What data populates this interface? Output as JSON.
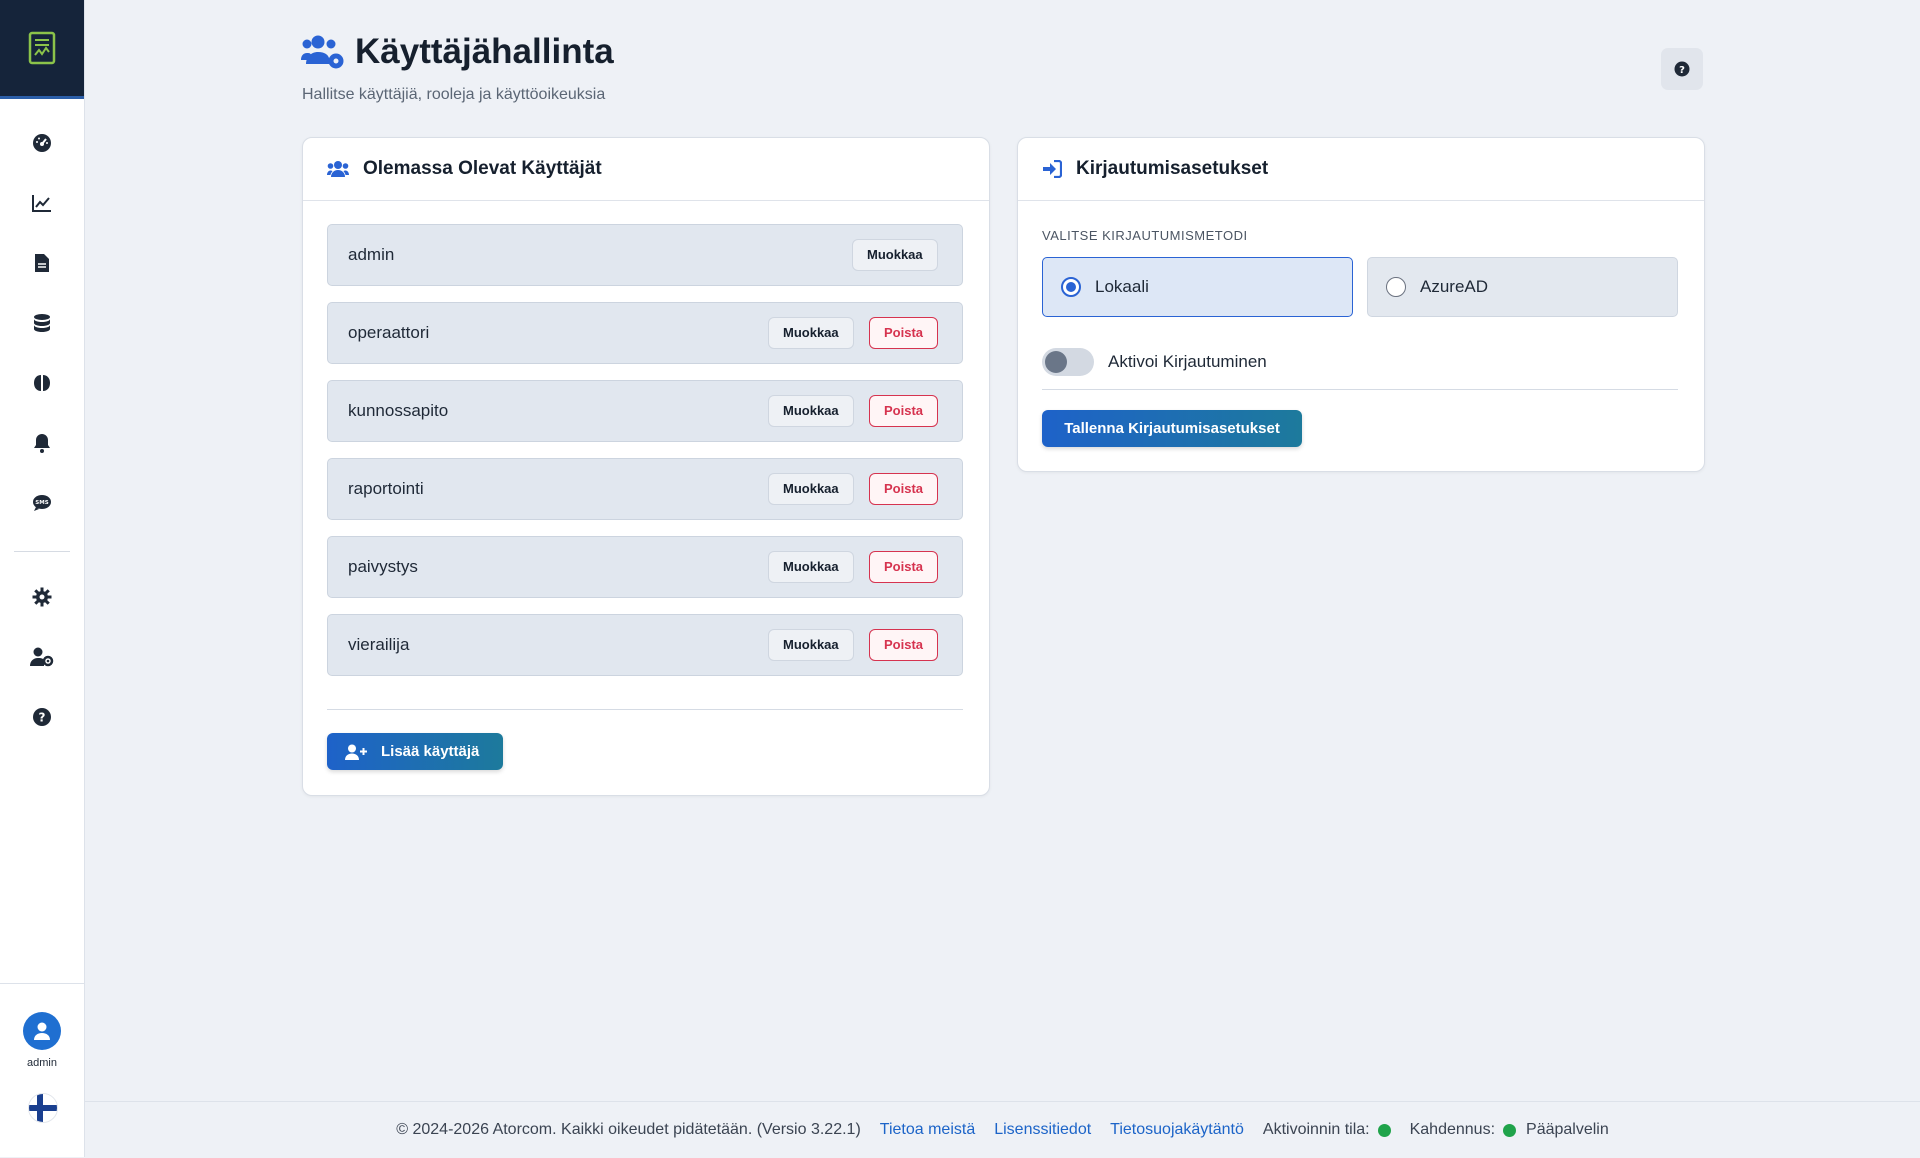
{
  "app": {
    "title": "Käyttäjähallinta",
    "subtitle": "Hallitse käyttäjiä, rooleja ja käyttöoikeuksia"
  },
  "sidebar": {
    "user_name": "admin",
    "icons": [
      "dashboard-icon",
      "chart-line-icon",
      "document-icon",
      "database-icon",
      "brain-icon",
      "bell-icon",
      "sms-icon",
      "gear-icon",
      "user-gear-icon",
      "help-icon"
    ]
  },
  "users_card": {
    "title": "Olemassa Olevat Käyttäjät",
    "edit_label": "Muokkaa",
    "delete_label": "Poista",
    "add_label": "Lisää käyttäjä",
    "users": [
      {
        "name": "admin"
      },
      {
        "name": "operaattori"
      },
      {
        "name": "kunnossapito"
      },
      {
        "name": "raportointi"
      },
      {
        "name": "paivystys"
      },
      {
        "name": "vierailija"
      }
    ]
  },
  "login_card": {
    "title": "Kirjautumisasetukset",
    "method_label": "VALITSE KIRJAUTUMISMETODI",
    "methods": [
      {
        "label": "Lokaali",
        "selected": true
      },
      {
        "label": "AzureAD",
        "selected": false
      }
    ],
    "toggle_label": "Aktivoi Kirjautuminen",
    "toggle_on": false,
    "save_label": "Tallenna Kirjautumisasetukset"
  },
  "footer": {
    "copyright": "© 2024-2026 Atorcom. Kaikki oikeudet pidätetään. (Versio 3.22.1)",
    "about": "Tietoa meistä",
    "license": "Lisenssitiedot",
    "privacy": "Tietosuojakäytäntö",
    "activation_label": "Aktivoinnin tila:",
    "duplication_label": "Kahdennus:",
    "server_label": "Pääpalvelin",
    "status_color": "#1fa34a"
  },
  "colors": {
    "accent": "#1e62c9",
    "danger": "#d6334f",
    "sidebar_logo_bg": "#15243a"
  }
}
